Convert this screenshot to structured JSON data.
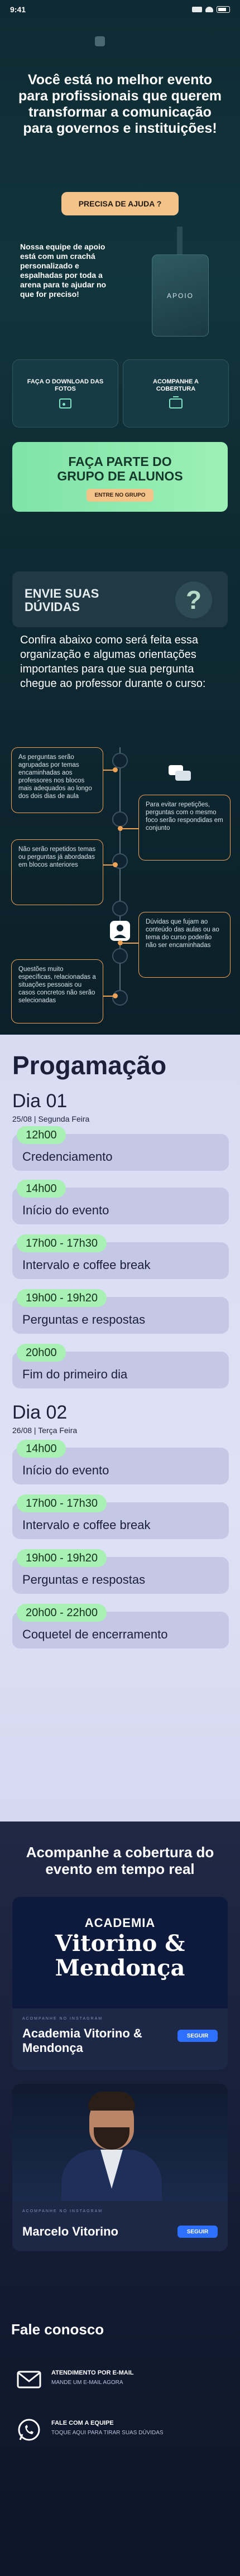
{
  "status_bar": {
    "time": "9:41"
  },
  "hero": {
    "title": "Você está no melhor evento para profissionais que querem transformar a comunicação para governos e instituições!",
    "help_button": "PRECISA DE AJUDA ?",
    "badge_text": "Nossa equipe de apoio está com um crachá personalizado e espalhadas por toda a arena para te ajudar no que for preciso!",
    "badge_card_label": "APOIO",
    "download_card": "FAÇA O DOWNLOAD DAS FOTOS",
    "follow_card": "ACOMPANHE A COBERTURA",
    "group_title": "FAÇA PARTE DO GRUPO DE ALUNOS",
    "group_button": "ENTRE NO GRUPO"
  },
  "doubts": {
    "title": "ENVIE SUAS DÚVIDAS",
    "intro": "Confira abaixo como será feita essa organização e algumas orientações importantes para que sua pergunta chegue ao professor durante o curso:",
    "tips": [
      "As perguntas serão agrupadas por temas encaminhadas aos professores nos blocos mais adequados ao longo dos dois dias de aula",
      "Para evitar repetições, perguntas com o mesmo foco serão respondidas em conjunto",
      "Não serão repetidos temas ou perguntas já abordadas em blocos anteriores",
      "Dúvidas que fujam ao conteúdo das aulas ou ao tema do curso poderão não ser encaminhadas",
      "Questões muito específicas, relacionadas a situações pessoais ou casos concretos não serão selecionadas"
    ]
  },
  "program": {
    "title": "Progamação",
    "day1": {
      "title": "Dia 01",
      "date": "25/08 | Segunda Feira"
    },
    "day1_items": [
      {
        "time": "12h00",
        "label": "Credenciamento"
      },
      {
        "time": "14h00",
        "label": "Início do evento"
      },
      {
        "time": "17h00 - 17h30",
        "label": "Intervalo e coffee break"
      },
      {
        "time": "19h00 - 19h20",
        "label": "Perguntas e respostas"
      },
      {
        "time": "20h00",
        "label": "Fim do primeiro dia"
      }
    ],
    "day2": {
      "title": "Dia 02",
      "date": "26/08 | Terça Feira"
    },
    "day2_items": [
      {
        "time": "14h00",
        "label": "Início do evento"
      },
      {
        "time": "17h00 - 17h30",
        "label": "Intervalo e coffee break"
      },
      {
        "time": "19h00 - 19h20",
        "label": "Perguntas e respostas"
      },
      {
        "time": "20h00 - 22h00",
        "label": "Coquetel de encerramento"
      }
    ]
  },
  "follow": {
    "title": "Acompanhe a cobertura do evento em tempo real",
    "profiles": [
      {
        "image_label": "ACADEMIA",
        "image_name": "Vitorino & Mendonça",
        "small": "ACOMPANHE NO INSTAGRAM",
        "name": "Academia Vitorino & Mendonça",
        "button": "SEGUIR"
      },
      {
        "small": "ACOMPANHE NO INSTAGRAM",
        "name": "Marcelo Vitorino",
        "button": "SEGUIR"
      }
    ]
  },
  "contact": {
    "title": "Fale conosco",
    "email_title": "ATENDIMENTO POR E-MAIL",
    "email_sub": "MANDE UM E-MAIL AGORA",
    "whats_title": "FALE COM A EQUIPE",
    "whats_sub": "TOQUE AQUI PARA TIRAR SUAS DÚVIDAS"
  }
}
